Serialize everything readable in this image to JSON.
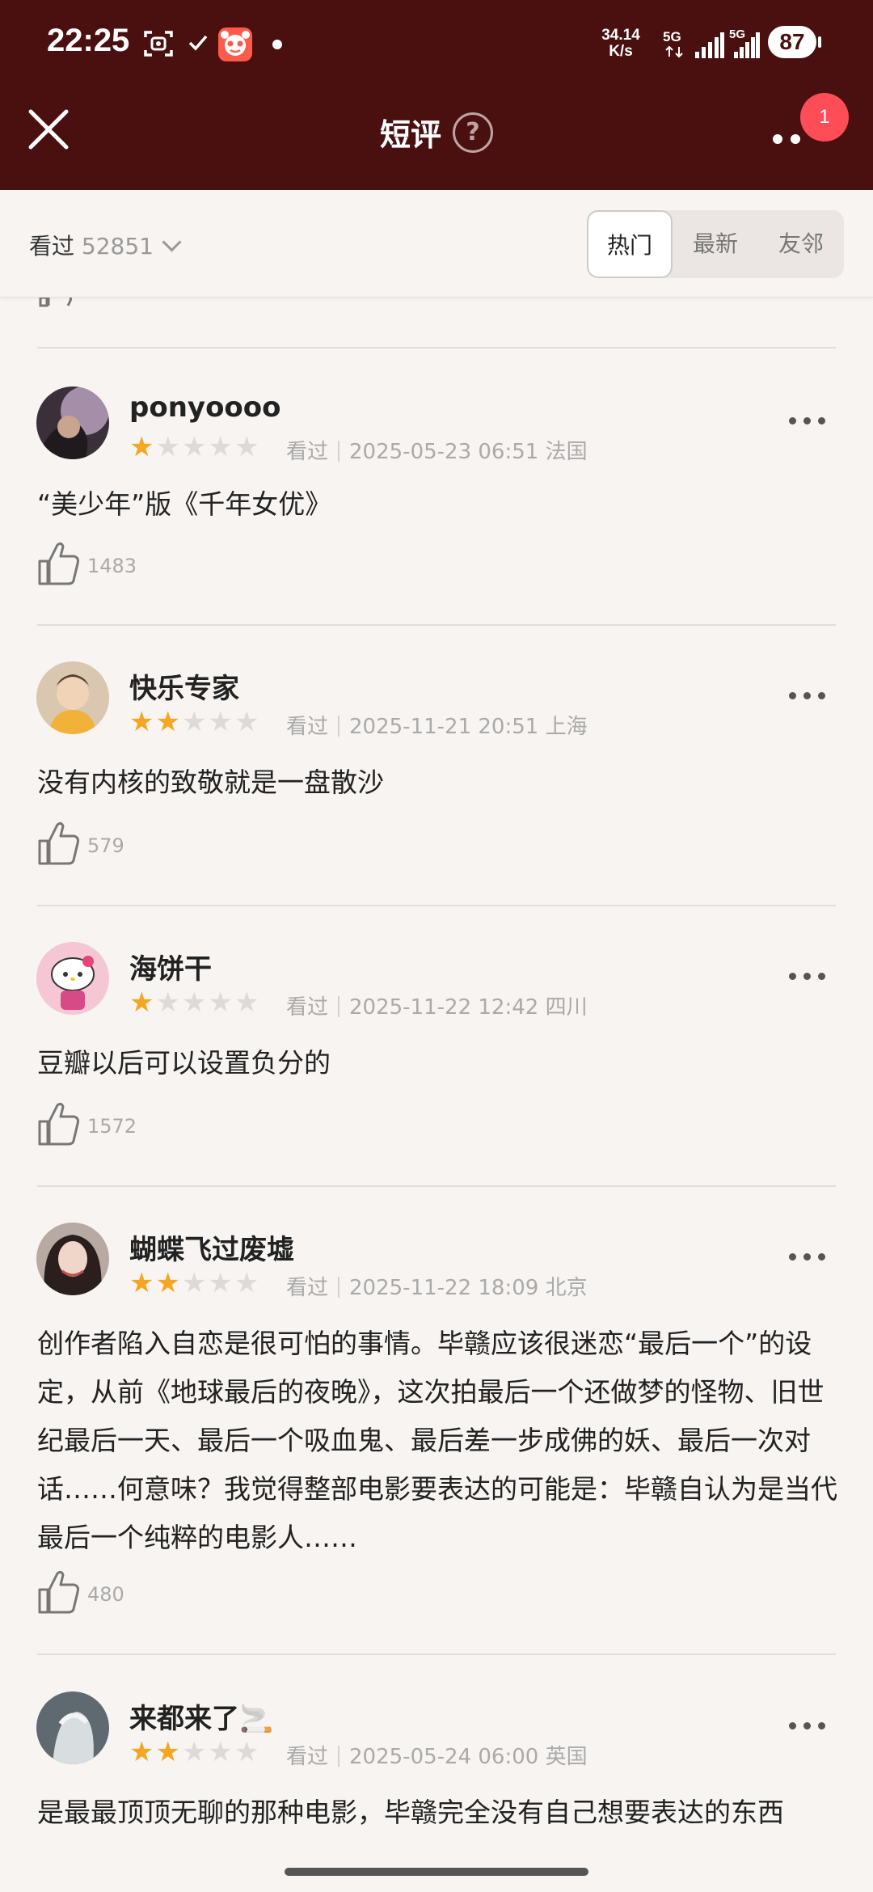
{
  "status_bar": {
    "time": "22:25",
    "net_speed_value": "34.14",
    "net_speed_unit": "K/s",
    "sim1": "5G",
    "sim2": "5G",
    "battery": "87"
  },
  "header": {
    "title": "短评",
    "help": "?",
    "notification_count": "1"
  },
  "filter": {
    "seen_label": "看过",
    "seen_count": "52851",
    "tabs": [
      {
        "label": "热门",
        "active": true
      },
      {
        "label": "最新",
        "active": false
      },
      {
        "label": "友邻",
        "active": false
      }
    ]
  },
  "reviews": [
    {
      "username": "ponyoooo",
      "rating": 1,
      "status": "看过",
      "datetime": "2025-05-23 06:51",
      "location": "法国",
      "content": "“美少年”版《千年女优》",
      "likes": "1483"
    },
    {
      "username": "快乐专家",
      "rating": 2,
      "status": "看过",
      "datetime": "2025-11-21 20:51",
      "location": "上海",
      "content": "没有内核的致敬就是一盘散沙",
      "likes": "579"
    },
    {
      "username": "海饼干",
      "rating": 1,
      "status": "看过",
      "datetime": "2025-11-22 12:42",
      "location": "四川",
      "content": "豆瓣以后可以设置负分的",
      "likes": "1572"
    },
    {
      "username": "蝴蝶飞过废墟",
      "rating": 2,
      "status": "看过",
      "datetime": "2025-11-22 18:09",
      "location": "北京",
      "content": "创作者陷入自恋是很可怕的事情。毕赣应该很迷恋“最后一个”的设定，从前《地球最后的夜晚》，这次拍最后一个还做梦的怪物、旧世纪最后一天、最后一个吸血鬼、最后差一步成佛的妖、最后一次对话……何意味？我觉得整部电影要表达的可能是：毕赣自认为是当代最后一个纯粹的电影人……",
      "likes": "480"
    },
    {
      "username": "来都来了🚬",
      "rating": 2,
      "status": "看过",
      "datetime": "2025-05-24 06:00",
      "location": "英国",
      "content": "是最最顶顶无聊的那种电影，毕赣完全没有自己想要表达的东西",
      "likes": ""
    }
  ]
}
